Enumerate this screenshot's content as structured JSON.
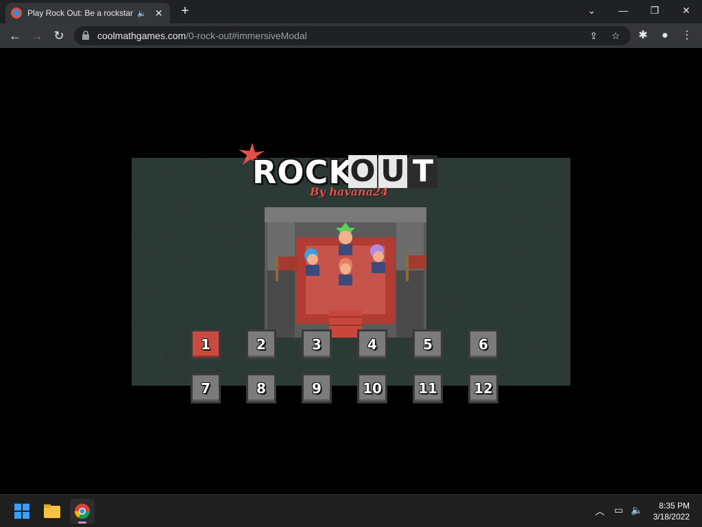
{
  "browser": {
    "tab": {
      "title": "Play Rock Out: Be a rockstar",
      "audio_icon": "speaker-icon",
      "close_label": "✕"
    },
    "new_tab_label": "+",
    "window_controls": {
      "tab_search": "⌄",
      "minimize": "—",
      "restore": "❐",
      "close": "✕"
    },
    "url": {
      "host": "coolmathgames.com",
      "path": "/0-rock-out#immersiveModal"
    }
  },
  "game": {
    "title_rock": "ROCK",
    "title_out": [
      "O",
      "U",
      "T"
    ],
    "author": "By havana24",
    "levels": [
      {
        "label": "1",
        "active": true
      },
      {
        "label": "2"
      },
      {
        "label": "3"
      },
      {
        "label": "4"
      },
      {
        "label": "5"
      },
      {
        "label": "6"
      },
      {
        "label": "7"
      },
      {
        "label": "8"
      },
      {
        "label": "9"
      },
      {
        "label": "10"
      },
      {
        "label": "11"
      },
      {
        "label": "12"
      }
    ]
  },
  "taskbar": {
    "time": "8:35 PM",
    "date": "3/18/2022"
  },
  "colors": {
    "chrome_dark": "#202124",
    "chrome_toolbar": "#35363a",
    "level_active": "#c94b3f",
    "level_idle": "#7b7b7b",
    "game_bg": "#2c3a36"
  }
}
